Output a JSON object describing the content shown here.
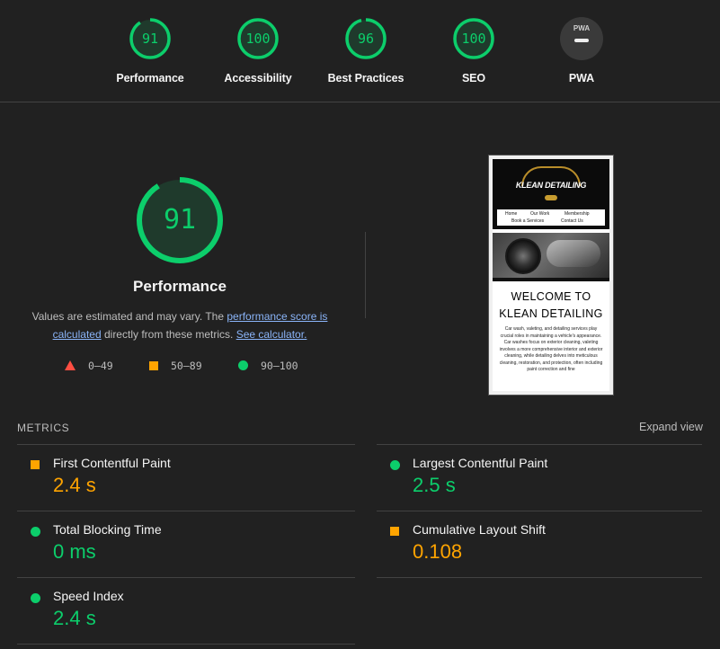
{
  "colors": {
    "pass": "#0cce6b",
    "average": "#ffa400",
    "fail": "#ff4e42",
    "background": "#212121",
    "link": "#8ab4f8"
  },
  "gauges": [
    {
      "score": "91",
      "label": "Performance",
      "fraction": 0.91
    },
    {
      "score": "100",
      "label": "Accessibility",
      "fraction": 1.0
    },
    {
      "score": "96",
      "label": "Best Practices",
      "fraction": 0.96
    },
    {
      "score": "100",
      "label": "SEO",
      "fraction": 1.0
    },
    {
      "badge": "PWA",
      "label": "PWA"
    }
  ],
  "performance": {
    "score": "91",
    "fraction": 0.91,
    "title": "Performance",
    "desc_prefix": "Values are estimated and may vary. The ",
    "desc_link1": "performance score is calculated",
    "desc_middle": " directly from these metrics. ",
    "desc_link2": "See calculator.",
    "legend": {
      "fail": "0–49",
      "average": "50–89",
      "pass": "90–100"
    }
  },
  "screenshot": {
    "logo_text": "KLEAN DETAILING",
    "nav": [
      "Home",
      "Our Work",
      "Membership",
      "Book a Services",
      "Contact Us"
    ],
    "welcome": "WELCOME TO KLEAN DETAILING",
    "paragraph": "Car wash, valeting, and detailing services play crucial roles in maintaining a vehicle's appearance. Car washes focus on exterior cleaning, valeting involves a more comprehensive interior and exterior cleaning, while detailing delves into meticulous cleaning, restoration, and protection, often including paint correction and fine"
  },
  "metrics": {
    "header": "METRICS",
    "expand_label": "Expand view",
    "items": [
      {
        "name": "First Contentful Paint",
        "value": "2.4 s",
        "status": "average"
      },
      {
        "name": "Largest Contentful Paint",
        "value": "2.5 s",
        "status": "pass"
      },
      {
        "name": "Total Blocking Time",
        "value": "0 ms",
        "status": "pass"
      },
      {
        "name": "Cumulative Layout Shift",
        "value": "0.108",
        "status": "average"
      },
      {
        "name": "Speed Index",
        "value": "2.4 s",
        "status": "pass"
      }
    ]
  }
}
